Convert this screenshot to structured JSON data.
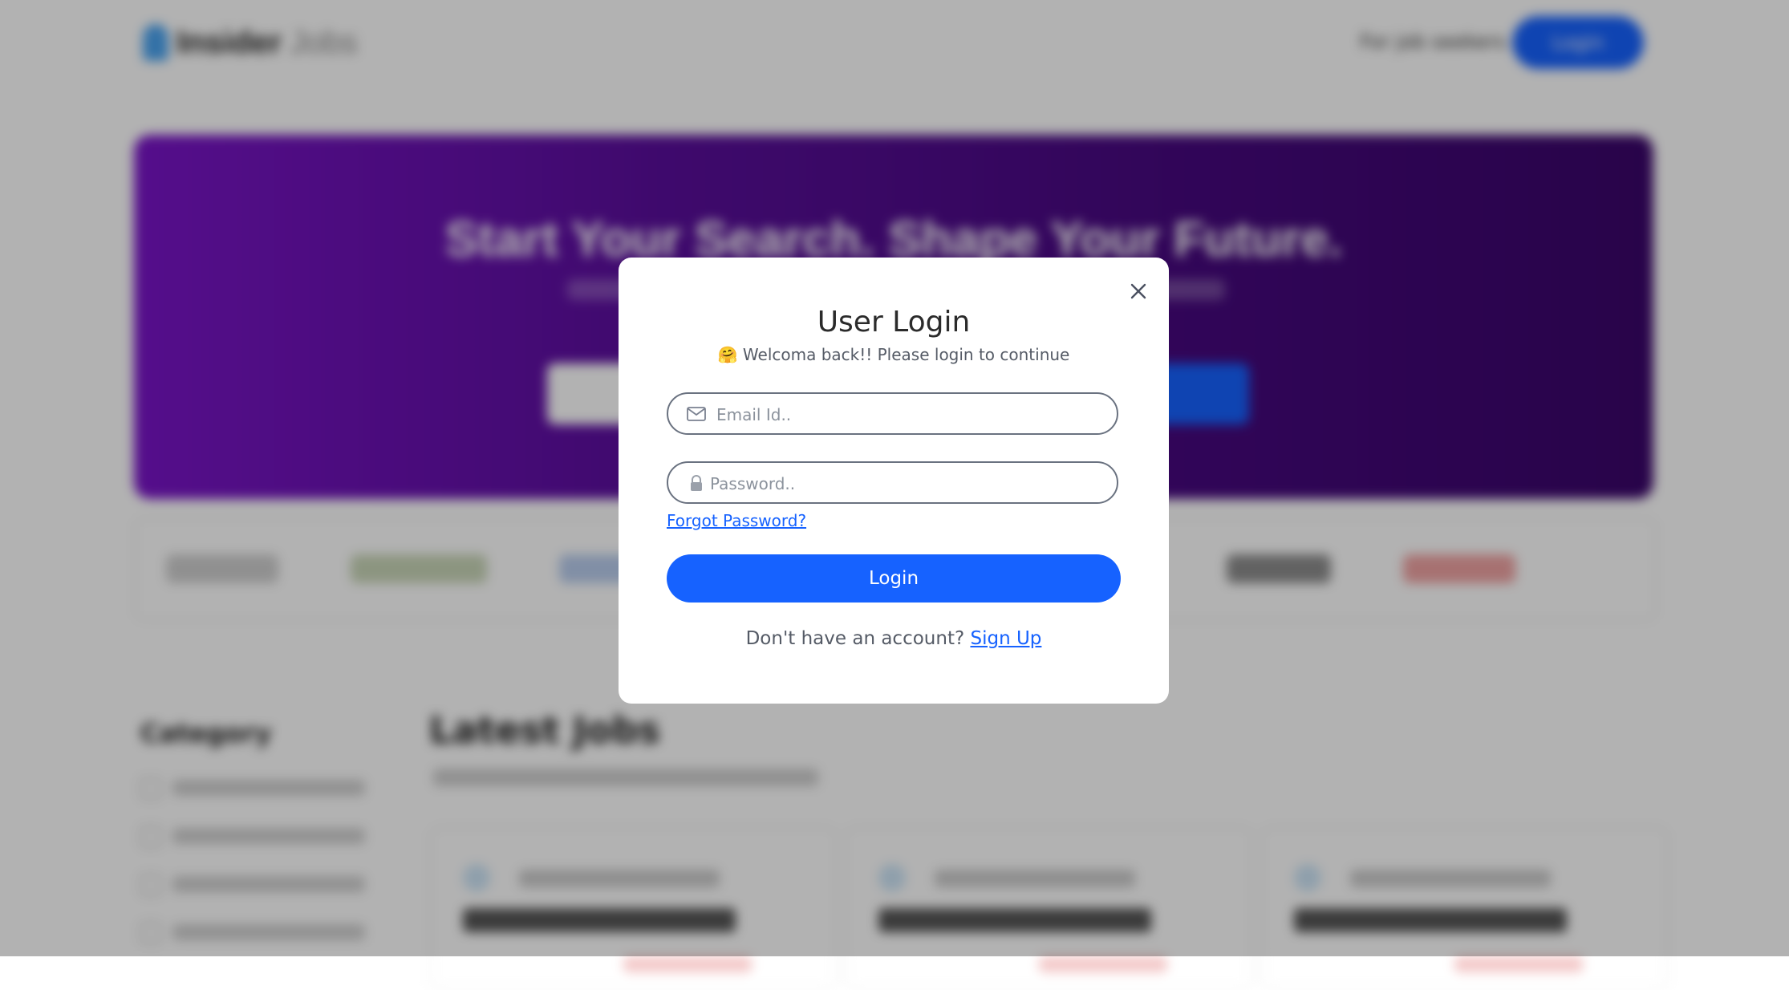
{
  "background": {
    "nav": {
      "logo_text_bold": "Insider",
      "logo_text_light": "Jobs",
      "link_label": "For job seekers",
      "button_label": "Login"
    },
    "hero": {
      "headline": "Start Your Search. Shape Your Future."
    },
    "sidebar": {
      "title": "Category"
    },
    "jobs": {
      "title": "Latest Jobs"
    }
  },
  "modal": {
    "title": "User Login",
    "subtitle_emoji": "🤗",
    "subtitle": "Welcoma back!! Please login to continue",
    "email_placeholder": "Email Id..",
    "password_placeholder": "Password..",
    "forgot_label": "Forgot Password?",
    "login_label": "Login",
    "signup_prompt": "Don't have an account?",
    "signup_link": "Sign Up"
  },
  "colors": {
    "primary": "#1662ff",
    "hero_start": "#7a14c8",
    "hero_end": "#3a066a"
  },
  "icons": [
    "close-icon",
    "mail-icon",
    "lock-icon"
  ]
}
